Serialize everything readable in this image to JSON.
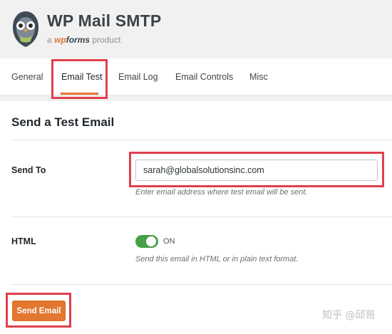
{
  "brand": {
    "title": "WP Mail SMTP",
    "sub_prefix": "a",
    "sub_wp": "wp",
    "sub_forms": "forms",
    "sub_suffix": "product"
  },
  "tabs": [
    {
      "label": "General",
      "active": false
    },
    {
      "label": "Email Test",
      "active": true
    },
    {
      "label": "Email Log",
      "active": false
    },
    {
      "label": "Email Controls",
      "active": false
    },
    {
      "label": "Misc",
      "active": false
    }
  ],
  "section": {
    "title": "Send a Test Email"
  },
  "send_to": {
    "label": "Send To",
    "value": "sarah@globalsolutionsinc.com",
    "description": "Enter email address where test email will be sent."
  },
  "html": {
    "label": "HTML",
    "toggle_state": "ON",
    "description": "Send this email in HTML or in plain text format."
  },
  "actions": {
    "send_label": "Send Email"
  },
  "watermark": "知乎 @邱哥",
  "colors": {
    "accent": "#e27730",
    "highlight": "#e0404c",
    "toggle_on": "#46a046"
  }
}
